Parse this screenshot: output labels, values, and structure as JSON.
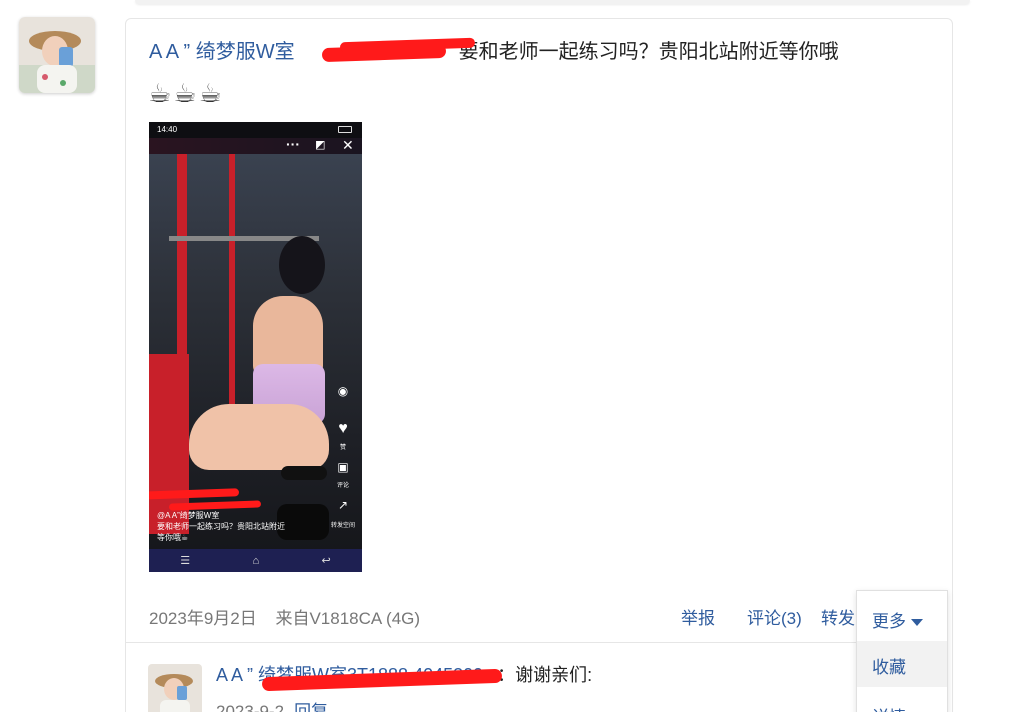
{
  "post": {
    "username": "A A ” 绮梦服W室",
    "text": "要和老师一起练习吗？贵阳北站附近等你哦",
    "emojis": "☕☕☕",
    "date": "2023年9月2日",
    "source": "来自V1818CA (4G)"
  },
  "media": {
    "status_time": "14:40",
    "caption_line1": "@A A”绮梦服W室",
    "caption_line2": "要和老师一起练习吗？贵阳北站附近",
    "caption_line3": "等你哦☕",
    "side_like": "赞",
    "side_comment": "评论",
    "side_share": "转发空间"
  },
  "actions": {
    "report": "举报",
    "comment": "评论(3)",
    "forward": "转发",
    "more": "更多"
  },
  "dropdown": {
    "favorite": "收藏",
    "details": "详情"
  },
  "reply": {
    "username": "A A ” 绮梦服W室3T1888 4045309",
    "text": "：谢谢亲们:",
    "date": "2023-9-2",
    "reply_label": "回复"
  },
  "colors": {
    "link": "#2f5c9e",
    "redaction": "#ff1a1a"
  }
}
